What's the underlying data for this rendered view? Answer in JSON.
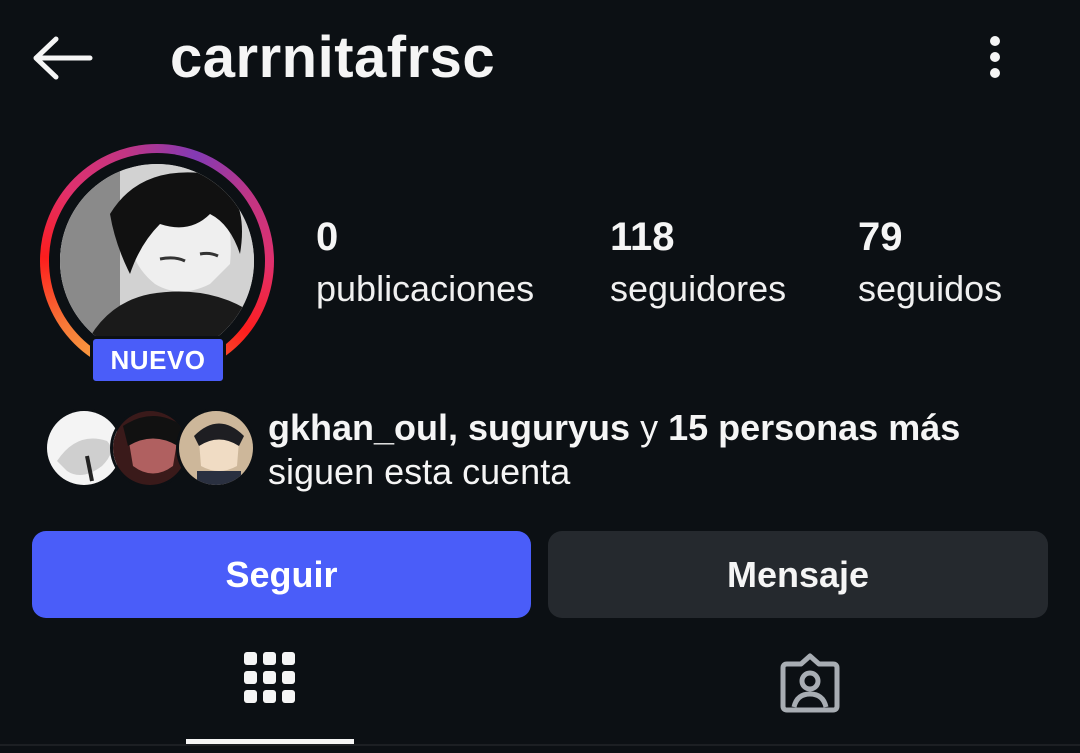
{
  "header": {
    "username": "carrnitafrsc",
    "back_icon": "arrow-left-icon",
    "more_icon": "more-vertical-icon"
  },
  "profile": {
    "badge": "NUEVO",
    "ring_colors": [
      "#fcaf45",
      "#f77737",
      "#fd1d1d",
      "#e1306c",
      "#c13584",
      "#833ab4"
    ],
    "stats": [
      {
        "value": "0",
        "label": "publicaciones"
      },
      {
        "value": "118",
        "label": "seguidores"
      },
      {
        "value": "79",
        "label": "seguidos"
      }
    ]
  },
  "followed_by": {
    "names": "gkhan_oul, suguryus",
    "connector": " y ",
    "more": "15 personas más",
    "suffix": "siguen esta cuenta"
  },
  "actions": {
    "follow_label": "Seguir",
    "message_label": "Mensaje",
    "accent": "#4a5df9"
  },
  "tabs": [
    {
      "icon": "grid-icon",
      "selected": true
    },
    {
      "icon": "tagged-person-icon",
      "selected": false
    }
  ]
}
